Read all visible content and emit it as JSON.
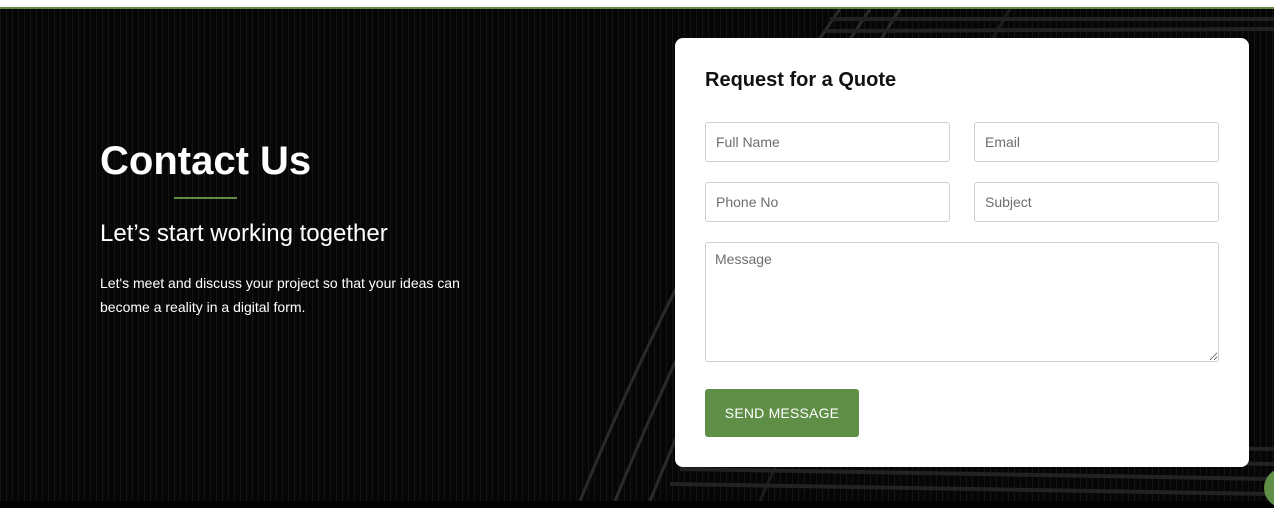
{
  "hero": {
    "title": "Contact Us",
    "tagline": "Let’s start working together",
    "blurb": "Let's meet and discuss your project so that your ideas can become a reality in a digital form.",
    "accent_color": "#5f8f46"
  },
  "form": {
    "heading": "Request for a Quote",
    "full_name_placeholder": "Full Name",
    "email_placeholder": "Email",
    "phone_placeholder": "Phone No",
    "subject_placeholder": "Subject",
    "message_placeholder": "Message",
    "send_label": "SEND MESSAGE"
  }
}
